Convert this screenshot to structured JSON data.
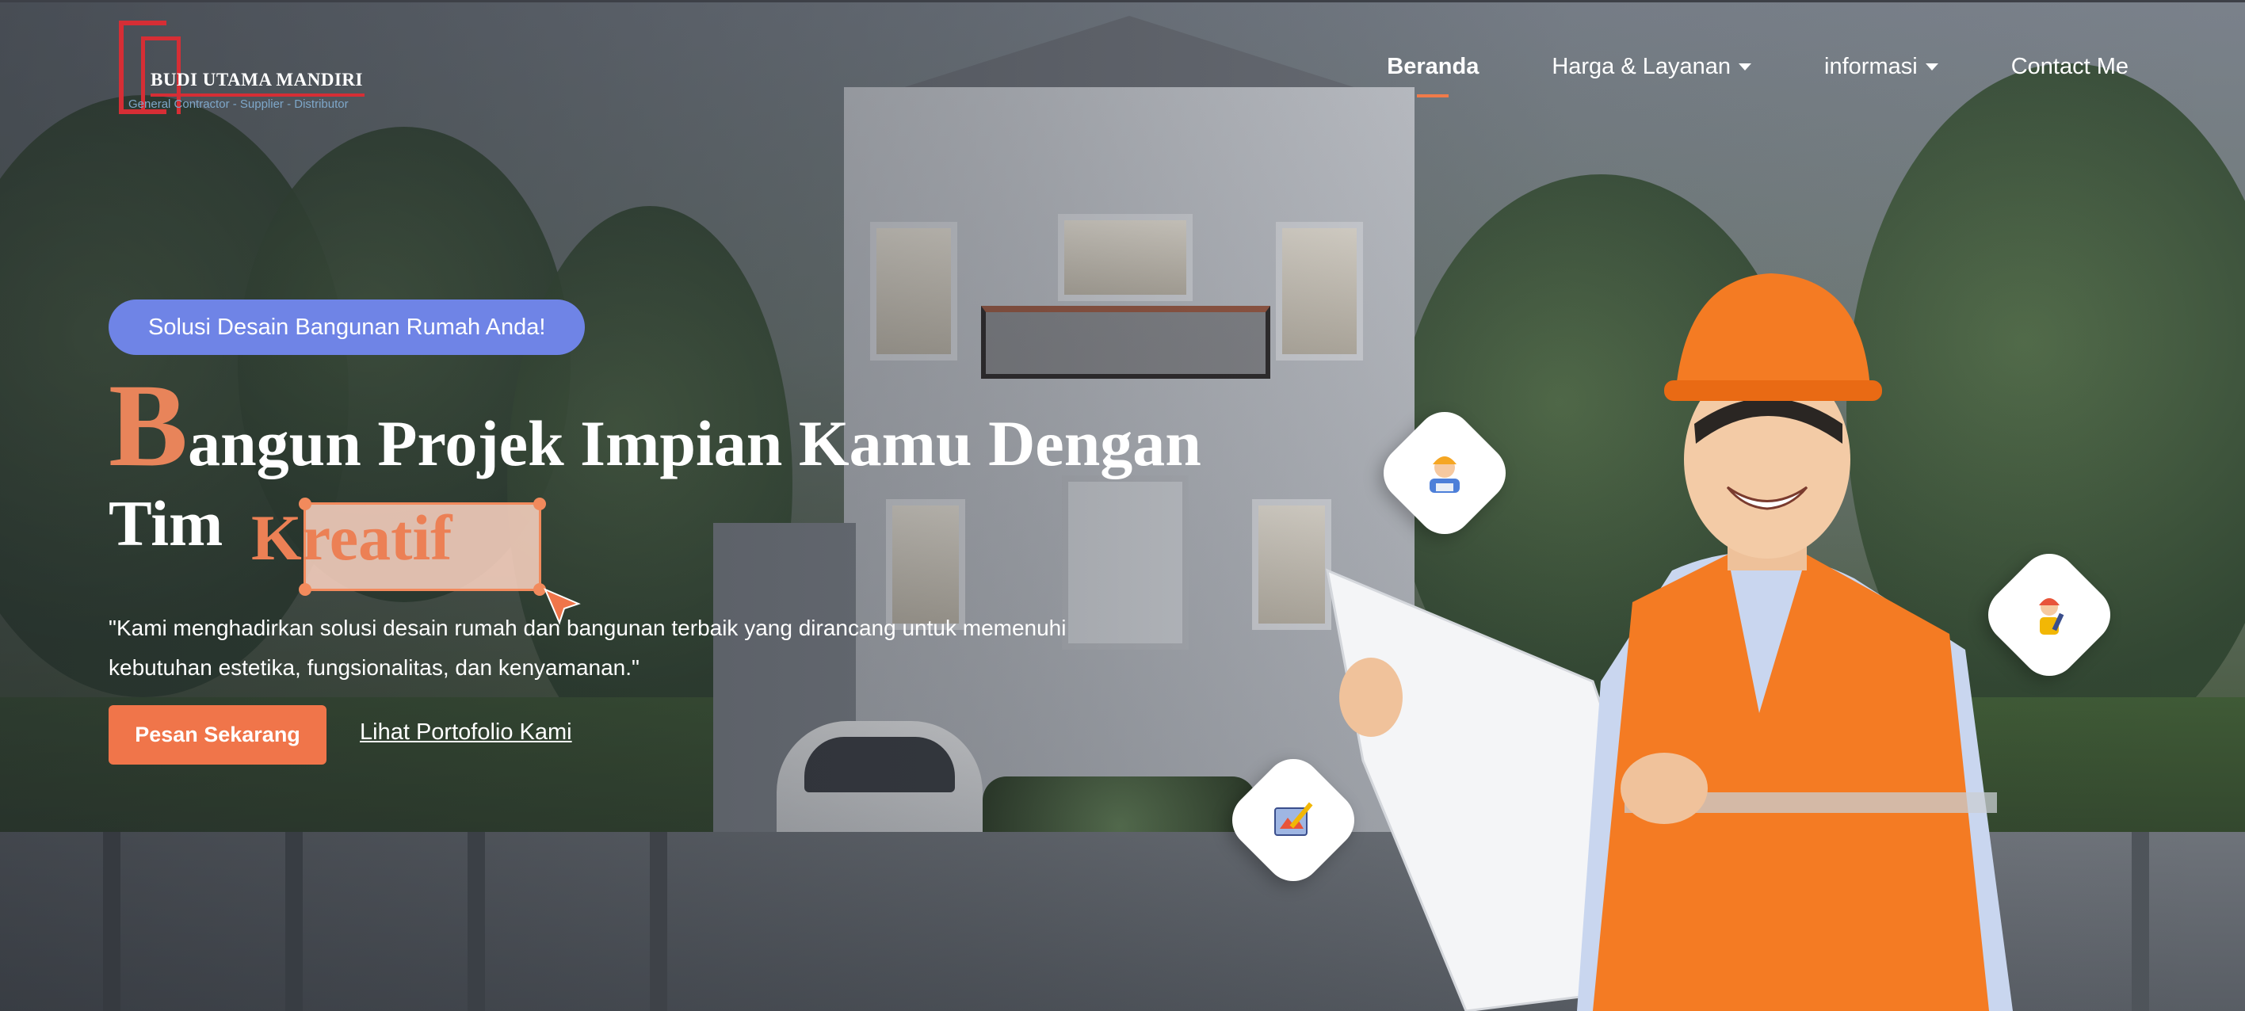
{
  "brand": {
    "name": "BUDI UTAMA MANDIRI",
    "tagline": "General Contractor - Supplier - Distributor",
    "colors": {
      "red": "#d62e35",
      "accent": "#f0754a",
      "pill": "#6f84e6"
    }
  },
  "nav": {
    "items": [
      {
        "label": "Beranda",
        "active": true,
        "dropdown": false
      },
      {
        "label": "Harga & Layanan",
        "active": false,
        "dropdown": true
      },
      {
        "label": "informasi",
        "active": false,
        "dropdown": true
      },
      {
        "label": "Contact Me",
        "active": false,
        "dropdown": false
      }
    ]
  },
  "hero": {
    "pill": "Solusi Desain Bangunan Rumah Anda!",
    "headline_initial": "B",
    "headline_line1_rest": "angun Projek Impian Kamu Dengan",
    "headline_line2_prefix": "Tim",
    "headline_accent": "Kreatif",
    "description": "\"Kami menghadirkan solusi desain rumah dan bangunan terbaik yang dirancang untuk memenuhi kebutuhan estetika, fungsionalitas, dan kenyamanan.\"",
    "primary_button": "Pesan Sekarang",
    "secondary_link": "Lihat Portofolio Kami"
  },
  "badges": [
    "engineer-icon",
    "worker-icon",
    "blueprint-icon"
  ]
}
